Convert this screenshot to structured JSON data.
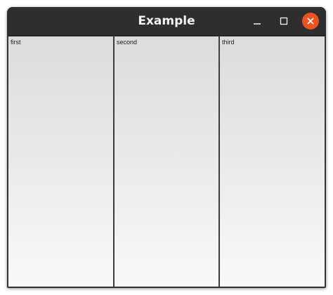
{
  "window": {
    "title": "Example",
    "controls": {
      "minimize_icon": "minimize-icon",
      "maximize_icon": "maximize-icon",
      "close_icon": "close-icon",
      "close_color": "#e95420"
    }
  },
  "panes": [
    {
      "label": "first"
    },
    {
      "label": "second"
    },
    {
      "label": "third"
    }
  ]
}
